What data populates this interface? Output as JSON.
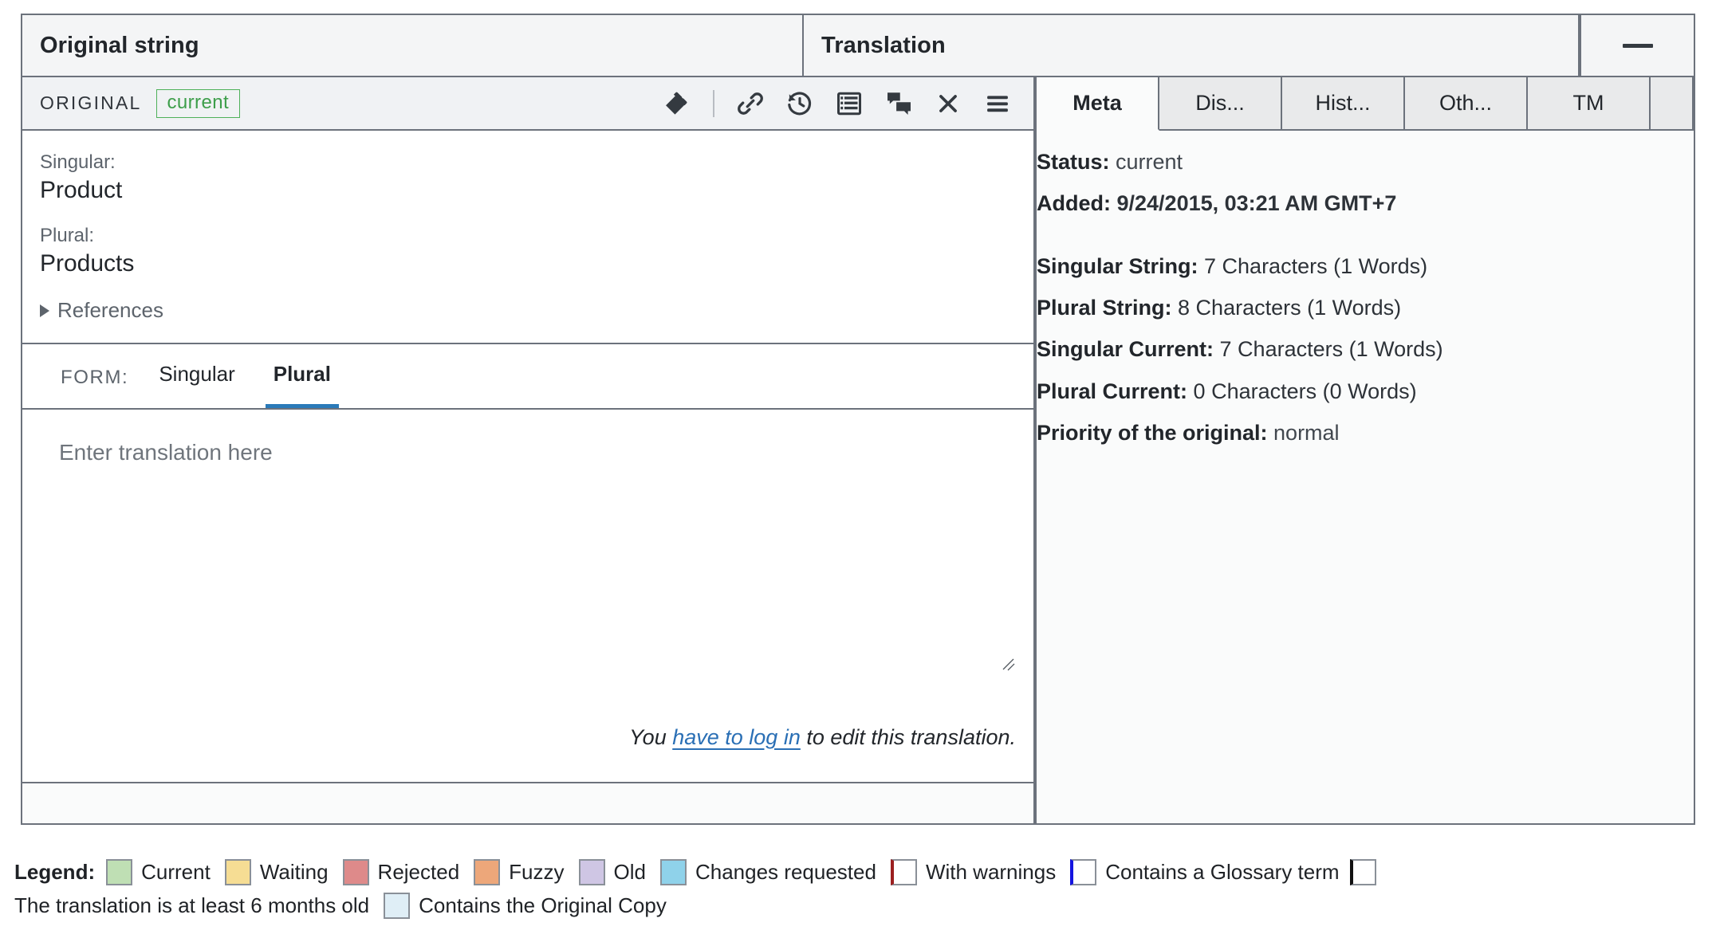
{
  "header": {
    "original_title": "Original string",
    "translation_title": "Translation",
    "minimize_label": "minimize"
  },
  "left_panel": {
    "original_label": "ORIGINAL",
    "status_chip": "current",
    "toolbar_icons": [
      {
        "name": "tag-icon",
        "title": "Tag"
      },
      {
        "name": "divider",
        "title": ""
      },
      {
        "name": "link-icon",
        "title": "Link"
      },
      {
        "name": "history-icon",
        "title": "History"
      },
      {
        "name": "list-icon",
        "title": "List"
      },
      {
        "name": "comments-icon",
        "title": "Comments"
      },
      {
        "name": "close-icon",
        "title": "Close"
      },
      {
        "name": "menu-icon",
        "title": "Menu"
      }
    ],
    "singular_label": "Singular:",
    "singular_value": "Product",
    "plural_label": "Plural:",
    "plural_value": "Products",
    "references_label": "References",
    "form_label": "FORM:",
    "form_tabs": [
      {
        "label": "Singular",
        "active": false
      },
      {
        "label": "Plural",
        "active": true
      }
    ],
    "textarea_placeholder": "Enter translation here",
    "login_note_prefix": "You ",
    "login_note_link": "have to log in",
    "login_note_suffix": " to edit this translation."
  },
  "right_panel": {
    "tabs": [
      {
        "label": "Meta",
        "active": true
      },
      {
        "label": "Dis...",
        "active": false
      },
      {
        "label": "Hist...",
        "active": false
      },
      {
        "label": "Oth...",
        "active": false
      },
      {
        "label": "TM",
        "active": false
      }
    ],
    "meta": {
      "status_key": "Status:",
      "status_value": "current",
      "added_key": "Added:",
      "added_value": "9/24/2015, 03:21 AM GMT+7",
      "singular_string_key": "Singular String:",
      "singular_string_value": "7 Characters (1 Words)",
      "plural_string_key": "Plural String:",
      "plural_string_value": "8 Characters (1 Words)",
      "singular_current_key": "Singular Current:",
      "singular_current_value": "7 Characters (1 Words)",
      "plural_current_key": "Plural Current:",
      "plural_current_value": "0 Characters (0 Words)",
      "priority_key": "Priority of the original:",
      "priority_value": "normal"
    }
  },
  "legend": {
    "title": "Legend:",
    "items_line1": [
      {
        "label": "Current",
        "color": "#bfdfb4",
        "border": "#8a9098"
      },
      {
        "label": "Waiting",
        "color": "#f6dd94",
        "border": "#8a9098"
      },
      {
        "label": "Rejected",
        "color": "#de8a8a",
        "border": "#8a9098"
      },
      {
        "label": "Fuzzy",
        "color": "#eda острови",
        "border": "#8a9098"
      },
      {
        "label": "Old",
        "color": "#cfc6e4",
        "border": "#8a9098"
      },
      {
        "label": "Changes requested",
        "color": "#8fd2ea",
        "border": "#8a9098"
      },
      {
        "label": "With warnings",
        "color": "#ffffff",
        "border": "#8a9098",
        "left_border": "#9b1f1f"
      },
      {
        "label": "Contains a Glossary term",
        "color": "#ffffff",
        "border": "#8a9098",
        "left_border": "#1414e0"
      }
    ],
    "line2_swatch": {
      "color": "#ffffff",
      "border": "#8a9098",
      "left_border": "#111111"
    },
    "line2_text": "The translation is at least 6 months old",
    "line2_swatch2": {
      "color": "#dfeef6",
      "border": "#8a9098"
    },
    "line2_text2": "Contains the Original Copy"
  }
}
